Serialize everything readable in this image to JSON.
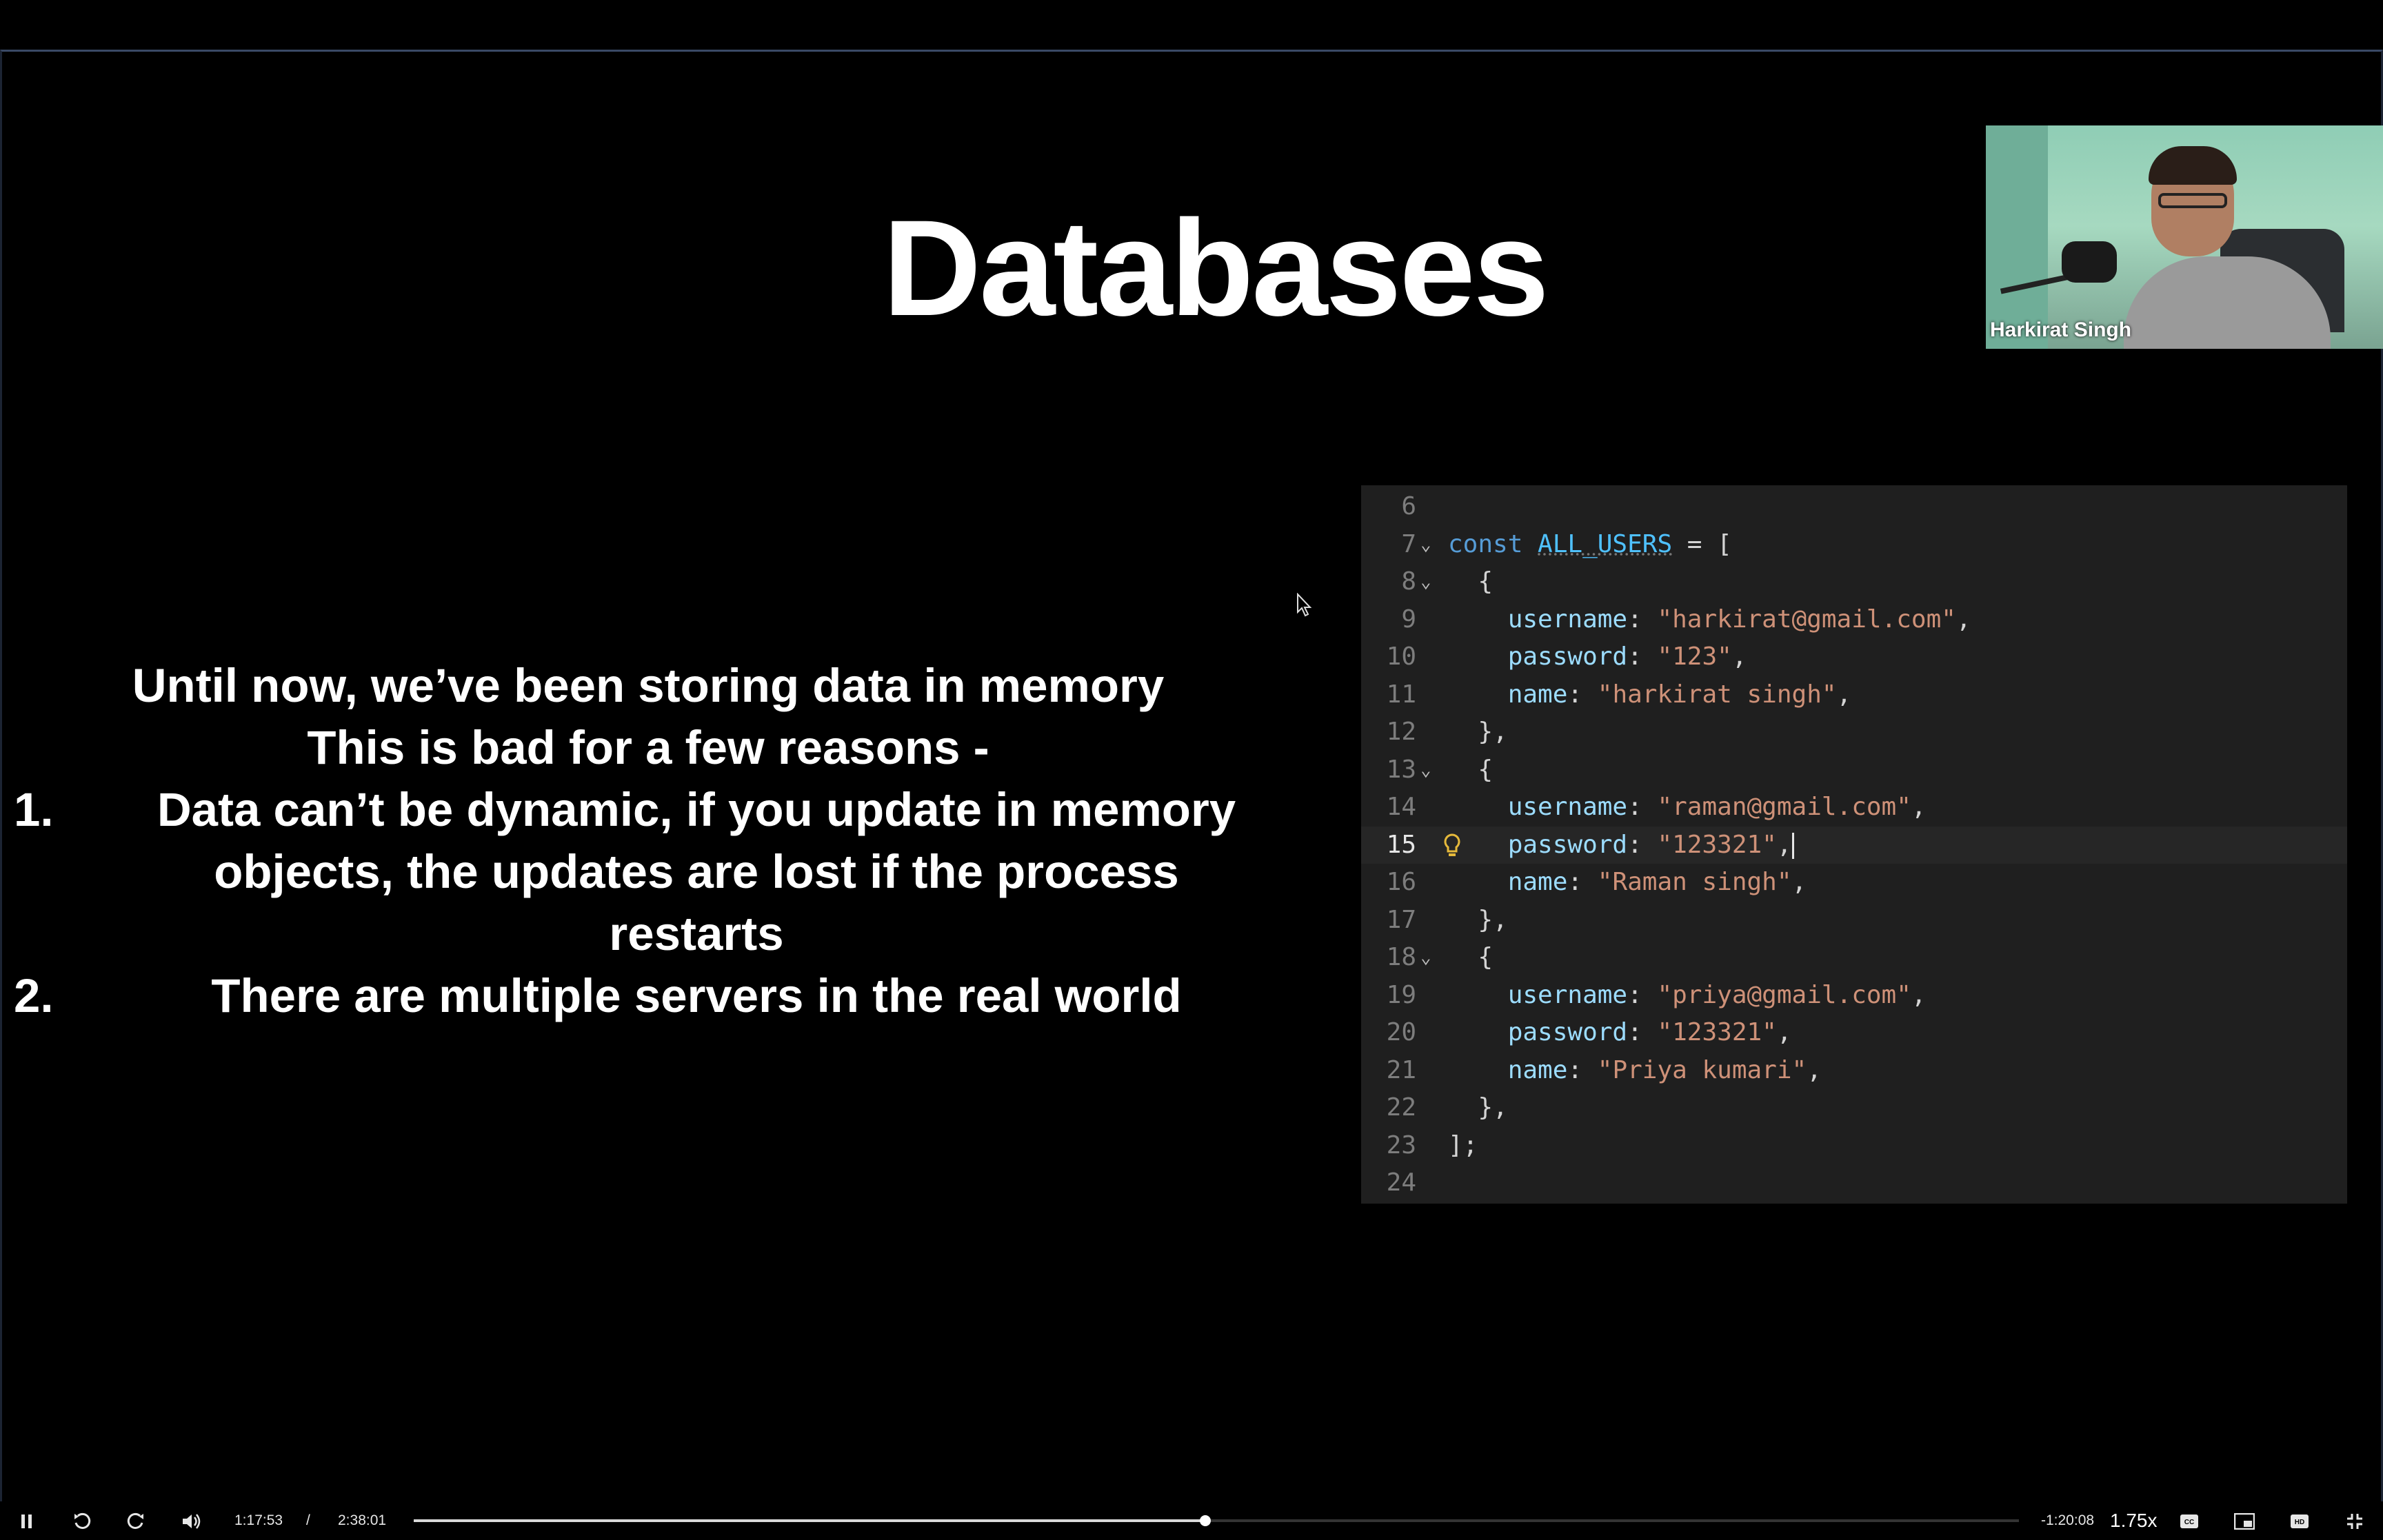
{
  "slide": {
    "title": "Databases",
    "intro_lines": [
      "Until now, we’ve been storing data in memory",
      "This is bad for a few reasons -"
    ],
    "points": [
      {
        "num": "1.",
        "lines": [
          "Data can’t be dynamic, if you update in memory",
          "objects, the updates are lost if the process",
          "restarts"
        ]
      },
      {
        "num": "2.",
        "lines": [
          "There are multiple servers in the real world"
        ]
      }
    ]
  },
  "webcam": {
    "presenter_name": "Harkirat Singh"
  },
  "code_editor": {
    "active_line": 15,
    "lines": [
      {
        "n": "6",
        "fold": false,
        "parts": []
      },
      {
        "n": "7",
        "fold": true,
        "parts": [
          [
            "kw",
            "const "
          ],
          [
            "var",
            "ALL_USERS"
          ],
          [
            "pun",
            " = ["
          ]
        ]
      },
      {
        "n": "8",
        "fold": true,
        "parts": [
          [
            "pun",
            "  {"
          ]
        ]
      },
      {
        "n": "9",
        "fold": false,
        "parts": [
          [
            "pun",
            "    "
          ],
          [
            "prop",
            "username"
          ],
          [
            "pun",
            ": "
          ],
          [
            "str",
            "\"harkirat@gmail.com\""
          ],
          [
            "pun",
            ","
          ]
        ]
      },
      {
        "n": "10",
        "fold": false,
        "parts": [
          [
            "pun",
            "    "
          ],
          [
            "prop",
            "password"
          ],
          [
            "pun",
            ": "
          ],
          [
            "str",
            "\"123\""
          ],
          [
            "pun",
            ","
          ]
        ]
      },
      {
        "n": "11",
        "fold": false,
        "parts": [
          [
            "pun",
            "    "
          ],
          [
            "prop",
            "name"
          ],
          [
            "pun",
            ": "
          ],
          [
            "str",
            "\"harkirat singh\""
          ],
          [
            "pun",
            ","
          ]
        ]
      },
      {
        "n": "12",
        "fold": false,
        "parts": [
          [
            "pun",
            "  },"
          ]
        ]
      },
      {
        "n": "13",
        "fold": true,
        "parts": [
          [
            "pun",
            "  {"
          ]
        ]
      },
      {
        "n": "14",
        "fold": false,
        "parts": [
          [
            "pun",
            "    "
          ],
          [
            "prop",
            "username"
          ],
          [
            "pun",
            ": "
          ],
          [
            "str",
            "\"raman@gmail.com\""
          ],
          [
            "pun",
            ","
          ]
        ]
      },
      {
        "n": "15",
        "fold": false,
        "parts": [
          [
            "pun",
            "    "
          ],
          [
            "prop",
            "password"
          ],
          [
            "pun",
            ": "
          ],
          [
            "str",
            "\"123321\""
          ],
          [
            "pun",
            ","
          ]
        ]
      },
      {
        "n": "16",
        "fold": false,
        "parts": [
          [
            "pun",
            "    "
          ],
          [
            "prop",
            "name"
          ],
          [
            "pun",
            ": "
          ],
          [
            "str",
            "\"Raman singh\""
          ],
          [
            "pun",
            ","
          ]
        ]
      },
      {
        "n": "17",
        "fold": false,
        "parts": [
          [
            "pun",
            "  },"
          ]
        ]
      },
      {
        "n": "18",
        "fold": true,
        "parts": [
          [
            "pun",
            "  {"
          ]
        ]
      },
      {
        "n": "19",
        "fold": false,
        "parts": [
          [
            "pun",
            "    "
          ],
          [
            "prop",
            "username"
          ],
          [
            "pun",
            ": "
          ],
          [
            "str",
            "\"priya@gmail.com\""
          ],
          [
            "pun",
            ","
          ]
        ]
      },
      {
        "n": "20",
        "fold": false,
        "parts": [
          [
            "pun",
            "    "
          ],
          [
            "prop",
            "password"
          ],
          [
            "pun",
            ": "
          ],
          [
            "str",
            "\"123321\""
          ],
          [
            "pun",
            ","
          ]
        ]
      },
      {
        "n": "21",
        "fold": false,
        "parts": [
          [
            "pun",
            "    "
          ],
          [
            "prop",
            "name"
          ],
          [
            "pun",
            ": "
          ],
          [
            "str",
            "\"Priya kumari\""
          ],
          [
            "pun",
            ","
          ]
        ]
      },
      {
        "n": "22",
        "fold": false,
        "parts": [
          [
            "pun",
            "  },"
          ]
        ]
      },
      {
        "n": "23",
        "fold": false,
        "parts": [
          [
            "pun",
            "];"
          ]
        ]
      },
      {
        "n": "24",
        "fold": false,
        "parts": []
      }
    ]
  },
  "player": {
    "current_time": "1:17:53",
    "separator": "/",
    "duration": "2:38:01",
    "remaining": "-1:20:08",
    "speed": "1.75x",
    "progress_fraction": 0.493,
    "icons": {
      "play_pause": "pause-icon",
      "rewind": "rewind-icon",
      "forward": "forward-icon",
      "volume": "volume-icon",
      "captions": "captions-icon",
      "pip": "picture-in-picture-icon",
      "hd": "hd-icon",
      "fullscreen": "exit-fullscreen-icon"
    }
  }
}
